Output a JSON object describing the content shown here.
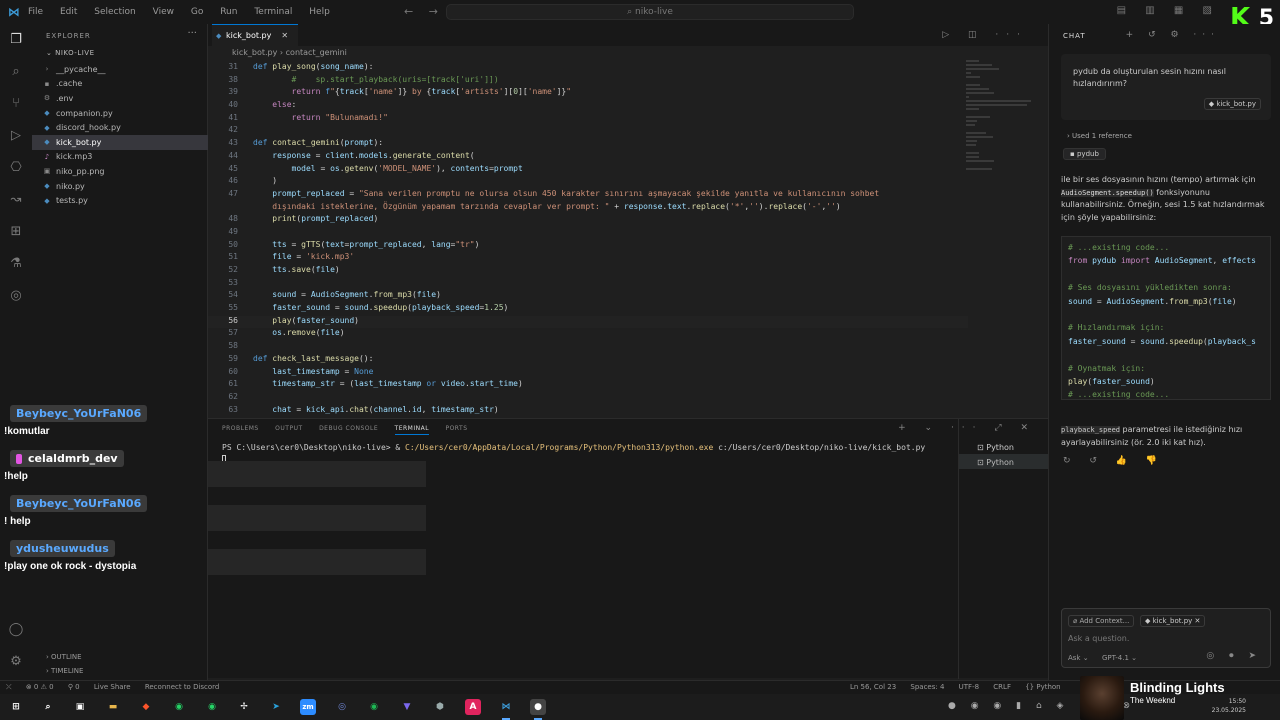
{
  "titlebar": {
    "menus": [
      "File",
      "Edit",
      "Selection",
      "View",
      "Go",
      "Run",
      "Terminal",
      "Help"
    ],
    "search": "niko-live",
    "stream_count": "5"
  },
  "sidebar": {
    "title": "EXPLORER",
    "project": "NIKO-LIVE",
    "items": [
      {
        "label": "__pycache__",
        "kind": "folder"
      },
      {
        "label": ".cache",
        "kind": "file"
      },
      {
        "label": ".env",
        "kind": "file"
      },
      {
        "label": "companion.py",
        "kind": "py"
      },
      {
        "label": "discord_hook.py",
        "kind": "py"
      },
      {
        "label": "kick_bot.py",
        "kind": "py",
        "active": true
      },
      {
        "label": "kick.mp3",
        "kind": "mp3"
      },
      {
        "label": "niko_pp.png",
        "kind": "img"
      },
      {
        "label": "niko.py",
        "kind": "py"
      },
      {
        "label": "tests.py",
        "kind": "py"
      }
    ],
    "outline": "OUTLINE",
    "timeline": "TIMELINE"
  },
  "stream_chat": [
    {
      "user": "Beybeyc_YoUrFaN06",
      "message": "!komutlar",
      "color": "#5aa9ff",
      "badge": false
    },
    {
      "user": "celaldmrb_dev",
      "message": "!help",
      "color": "#ffffff",
      "badge": true
    },
    {
      "user": "Beybeyc_YoUrFaN06",
      "message": "! help",
      "color": "#5aa9ff",
      "badge": false
    },
    {
      "user": "ydusheuwudus",
      "message": "!play one ok rock - dystopia",
      "color": "#5aa9ff",
      "badge": false
    }
  ],
  "editor": {
    "tab": "kick_bot.py",
    "breadcrumb_file": "kick_bot.py",
    "breadcrumb_symbol": "contact_gemini",
    "current_line": "56"
  },
  "code_lines": [
    {
      "n": "31",
      "html": "<span class='kw'>def</span> <span class='fn'>play_song</span>(<span class='va'>song_name</span>):"
    },
    {
      "n": "38",
      "html": "        <span class='cm'>#    sp.start_playback(uris=[track['uri']])</span>"
    },
    {
      "n": "39",
      "html": "        <span class='ctl'>return</span> <span class='kw'>f</span><span class='st'>\"</span>{<span class='va'>track</span>[<span class='st'>'name'</span>]} <span class='st'>by</span> {<span class='va'>track</span>[<span class='st'>'artists'</span>][<span class='num'>0</span>][<span class='st'>'name'</span>]}<span class='st'>\"</span>"
    },
    {
      "n": "40",
      "html": "    <span class='ctl'>else</span>:"
    },
    {
      "n": "41",
      "html": "        <span class='ctl'>return</span> <span class='st'>\"Bulunamadı!\"</span>"
    },
    {
      "n": "42",
      "html": ""
    },
    {
      "n": "43",
      "html": "<span class='kw'>def</span> <span class='fn'>contact_gemini</span>(<span class='va'>prompt</span>):"
    },
    {
      "n": "44",
      "html": "    <span class='va'>response</span> = <span class='va'>client</span>.<span class='va'>models</span>.<span class='fn'>generate_content</span>("
    },
    {
      "n": "45",
      "html": "        <span class='va'>model</span> = <span class='va'>os</span>.<span class='fn'>getenv</span>(<span class='st'>'MODEL_NAME'</span>), <span class='va'>contents</span>=<span class='va'>prompt</span>"
    },
    {
      "n": "46",
      "html": "    )"
    },
    {
      "n": "47",
      "html": "    <span class='va'>prompt_replaced</span> = <span class='st'>\"Sana verilen promptu ne olursa olsun 450 karakter sınırını aşmayacak şekilde yanıtla ve kullanıcının sohbet</span>"
    },
    {
      "n": "",
      "html": "    <span class='st'>dışındaki isteklerine, Özgünüm yapamam tarzında cevaplar ver prompt: \"</span> + <span class='va'>response</span>.<span class='va'>text</span>.<span class='fn'>replace</span>(<span class='st'>'*'</span>,<span class='st'>''</span>).<span class='fn'>replace</span>(<span class='st'>'-'</span>,<span class='st'>''</span>)"
    },
    {
      "n": "48",
      "html": "    <span class='fn'>print</span>(<span class='va'>prompt_replaced</span>)"
    },
    {
      "n": "49",
      "html": ""
    },
    {
      "n": "50",
      "html": "    <span class='va'>tts</span> = <span class='fn'>gTTS</span>(<span class='va'>text</span>=<span class='va'>prompt_replaced</span>, <span class='va'>lang</span>=<span class='st'>\"tr\"</span>)"
    },
    {
      "n": "51",
      "html": "    <span class='va'>file</span> = <span class='st'>'kick.mp3'</span>"
    },
    {
      "n": "52",
      "html": "    <span class='va'>tts</span>.<span class='fn'>save</span>(<span class='va'>file</span>)"
    },
    {
      "n": "53",
      "html": ""
    },
    {
      "n": "54",
      "html": "    <span class='va'>sound</span> = <span class='va'>AudioSegment</span>.<span class='fn'>from_mp3</span>(<span class='va'>file</span>)"
    },
    {
      "n": "55",
      "html": "    <span class='va'>faster_sound</span> = <span class='va'>sound</span>.<span class='fn'>speedup</span>(<span class='va'>playback_speed</span>=<span class='num'>1.25</span>)"
    },
    {
      "n": "56",
      "html": "    <span class='fn'>play</span>(<span class='va'>faster_sound</span>)"
    },
    {
      "n": "57",
      "html": "    <span class='va'>os</span>.<span class='fn'>remove</span>(<span class='va'>file</span>)"
    },
    {
      "n": "58",
      "html": ""
    },
    {
      "n": "59",
      "html": "<span class='kw'>def</span> <span class='fn'>check_last_message</span>():"
    },
    {
      "n": "60",
      "html": "    <span class='va'>last_timestamp</span> = <span class='kw'>None</span>"
    },
    {
      "n": "61",
      "html": "    <span class='va'>timestamp_str</span> = (<span class='va'>last_timestamp</span> <span class='kw'>or</span> <span class='va'>video</span>.<span class='va'>start_time</span>)"
    },
    {
      "n": "62",
      "html": ""
    },
    {
      "n": "63",
      "html": "    <span class='va'>chat</span> = <span class='va'>kick_api</span>.<span class='fn'>chat</span>(<span class='va'>channel</span>.<span class='va'>id</span>, <span class='va'>timestamp_str</span>)"
    }
  ],
  "panel": {
    "tabs": [
      "PROBLEMS",
      "OUTPUT",
      "DEBUG CONSOLE",
      "TERMINAL",
      "PORTS"
    ],
    "active_tab": "TERMINAL",
    "prompt": "PS C:\\Users\\cer0\\Desktop\\niko-live> & ",
    "command": "C:/Users/cer0/AppData/Local/Programs/Python/Python313/python.exe",
    "arg": " c:/Users/cer0/Desktop/niko-live/kick_bot.py",
    "terminals": [
      "Python",
      "Python"
    ]
  },
  "chat": {
    "title": "CHAT",
    "question": "pydub da oluşturulan sesin hızını nasıl hızlandırırım?",
    "question_file": "kick_bot.py",
    "reference": "Used 1 reference",
    "ref_chip": "pydub",
    "answer1_pre": "ile bir ses dosyasının hızını (tempo) artırmak için ",
    "answer1_code": "AudioSegment.speedup()",
    "answer1_post": " fonksiyonunu kullanabilirsiniz. Örneğin, sesi 1.5 kat hızlandırmak için şöyle yapabilirsiniz:",
    "answer2_code": "playback_speed",
    "answer2_post": " parametresi ile istediğiniz hızı ayarlayabilirsiniz (ör. 2.0 iki kat hız).",
    "add_context": "Add Context...",
    "context_file": "kick_bot.py",
    "placeholder": "Ask a question.",
    "mode": "Ask",
    "model": "GPT-4.1"
  },
  "chat_code": [
    "<span class='cm'># ...existing code...</span>",
    "<span class='ctl'>from</span> <span class='va'>pydub</span> <span class='ctl'>import</span> <span class='va'>AudioSegment</span>, <span class='va'>effects</span>",
    "",
    "<span class='cm'># Ses dosyasını yükledikten sonra:</span>",
    "<span class='va'>sound</span> = <span class='va'>AudioSegment</span>.<span class='fn'>from_mp3</span>(<span class='va'>file</span>)",
    "",
    "<span class='cm'># Hızlandırmak için:</span>",
    "<span class='va'>faster_sound</span> = <span class='va'>sound</span>.<span class='fn'>speedup</span>(<span class='va'>playback_s</span>",
    "",
    "<span class='cm'># Oynatmak için:</span>",
    "<span class='fn'>play</span>(<span class='va'>faster_sound</span>)",
    "<span class='cm'># ...existing code...</span>"
  ],
  "statusbar": {
    "left": [
      "⊗ 0 ⚠ 0",
      "⚲ 0",
      "Live Share",
      "Reconnect to Discord"
    ],
    "right": [
      "Ln 56, Col 23",
      "Spaces: 4",
      "UTF-8",
      "CRLF",
      "{} Python"
    ]
  },
  "now_playing": {
    "title": "Blinding Lights",
    "artist": "The Weeknd"
  },
  "clock": {
    "time": "15:50",
    "date": "23.05.2025"
  },
  "colors": {
    "accent": "#0078d4",
    "kick_green": "#53fc18"
  }
}
